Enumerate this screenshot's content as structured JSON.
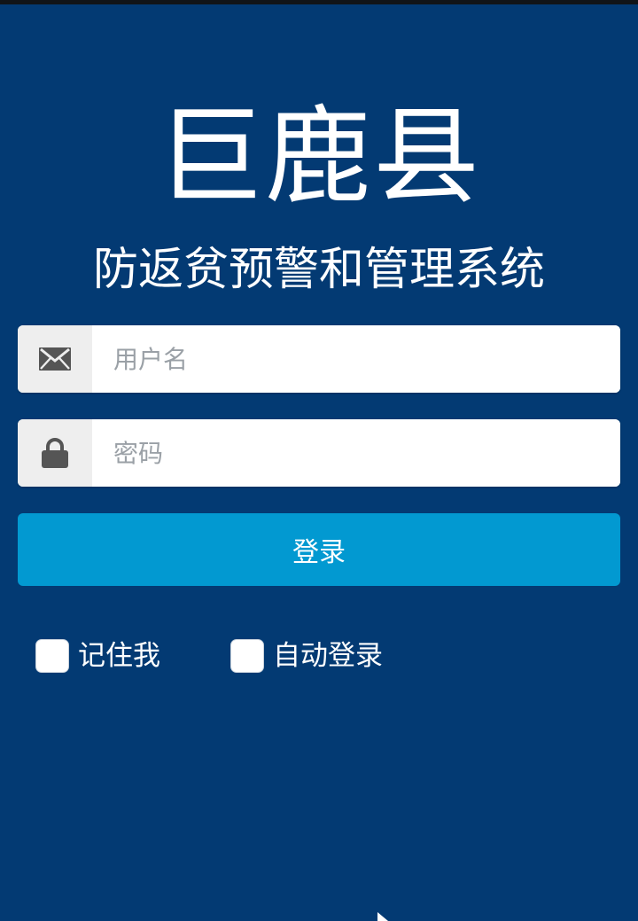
{
  "header": {
    "title": "巨鹿县",
    "subtitle": "防返贫预警和管理系统"
  },
  "form": {
    "username": {
      "icon": "envelope-icon",
      "placeholder": "用户名",
      "value": ""
    },
    "password": {
      "icon": "lock-icon",
      "placeholder": "密码",
      "value": ""
    },
    "login_label": "登录"
  },
  "options": {
    "remember_label": "记住我",
    "remember_checked": false,
    "auto_login_label": "自动登录",
    "auto_login_checked": false
  },
  "colors": {
    "background": "#033a73",
    "button": "#0299d1",
    "addon": "#eeeeee",
    "text": "#ffffff"
  }
}
